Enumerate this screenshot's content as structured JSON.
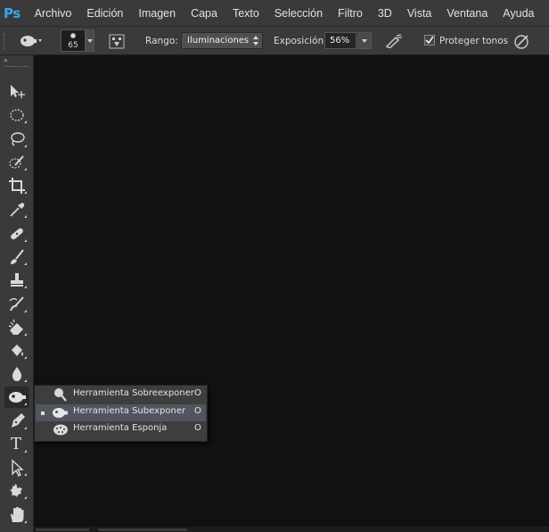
{
  "app": {
    "logo": "Ps"
  },
  "menu": [
    "Archivo",
    "Edición",
    "Imagen",
    "Capa",
    "Texto",
    "Selección",
    "Filtro",
    "3D",
    "Vista",
    "Ventana",
    "Ayuda"
  ],
  "options": {
    "brush_size": "65",
    "range_label": "Rango:",
    "range_value": "Iluminaciones",
    "exposure_label": "Exposición:",
    "exposure_value": "56%",
    "protect_tones_label": "Proteger tonos",
    "protect_tones_checked": true
  },
  "toolbar": {
    "collapse_glyph": "»",
    "tools": [
      "move-icon",
      "marquee-icon",
      "lasso-icon",
      "quick-selection-icon",
      "crop-icon",
      "eyedropper-icon",
      "healing-brush-icon",
      "brush-icon",
      "clone-stamp-icon",
      "history-brush-icon",
      "eraser-icon",
      "paint-bucket-icon",
      "blur-icon",
      "burn-icon",
      "pen-icon",
      "type-icon",
      "path-selection-icon",
      "custom-shape-icon",
      "hand-icon"
    ],
    "type_tool_glyph": "T"
  },
  "flyout": {
    "items": [
      {
        "label": "Herramienta Sobreexponer",
        "key": "O",
        "selected": false,
        "icon": "dodge-icon"
      },
      {
        "label": "Herramienta Subexponer",
        "key": "O",
        "selected": true,
        "icon": "burn-icon"
      },
      {
        "label": "Herramienta Esponja",
        "key": "O",
        "selected": false,
        "icon": "sponge-icon"
      }
    ]
  },
  "colors": {
    "chrome": "#3a3a3a",
    "canvas": "#111111",
    "accent": "#37a8f0",
    "selection": "#51555f"
  }
}
